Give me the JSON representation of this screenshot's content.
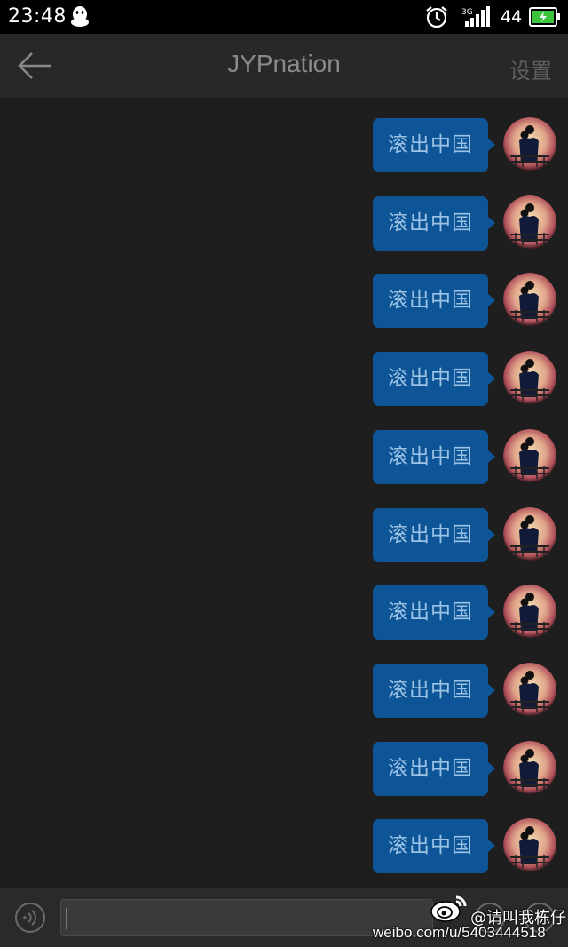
{
  "status_bar": {
    "time": "23:48",
    "network": "3G",
    "battery_level": "44",
    "icons": [
      "qq-icon",
      "alarm-icon",
      "signal-icon",
      "battery-icon"
    ]
  },
  "header": {
    "title": "JYPnation",
    "settings_label": "设置",
    "back_icon": "back-arrow-icon"
  },
  "messages": [
    {
      "text": "滚出中国",
      "sender": "self"
    },
    {
      "text": "滚出中国",
      "sender": "self"
    },
    {
      "text": "滚出中国",
      "sender": "self"
    },
    {
      "text": "滚出中国",
      "sender": "self"
    },
    {
      "text": "滚出中国",
      "sender": "self"
    },
    {
      "text": "滚出中国",
      "sender": "self"
    },
    {
      "text": "滚出中国",
      "sender": "self"
    },
    {
      "text": "滚出中国",
      "sender": "self"
    },
    {
      "text": "滚出中国",
      "sender": "self"
    },
    {
      "text": "滚出中国",
      "sender": "self"
    }
  ],
  "input_bar": {
    "value": "",
    "icons": [
      "voice-icon",
      "emoji-icon",
      "more-icon"
    ]
  },
  "watermark": {
    "handle": "@请叫我栋仔",
    "url": "weibo.com/u/5403444518"
  },
  "colors": {
    "background": "#1e1e1e",
    "bubble": "#0d5597",
    "bubble_text": "#9cc2e5",
    "title_text": "#8a8a8a"
  }
}
